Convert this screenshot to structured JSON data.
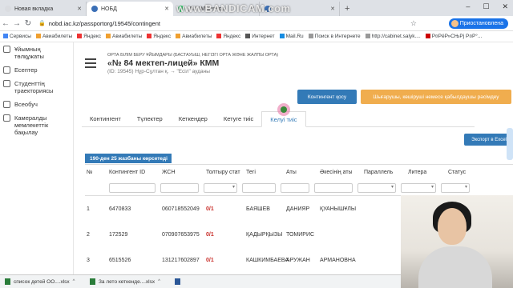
{
  "browser": {
    "tabs": [
      {
        "title": "Новая вкладка",
        "color": "#dadce0",
        "active": false
      },
      {
        "title": "НОБД",
        "color": "#3b6fb6",
        "active": true
      },
      {
        "title": "(63) WhatsApp",
        "color": "#25d366",
        "active": false
      },
      {
        "title": "",
        "color": "#3b6fb6",
        "active": false
      }
    ],
    "new_tab": "+",
    "window_buttons": [
      "–",
      "☐",
      "✕"
    ],
    "url": "nobd.iac.kz/passportorg/19545/contingent",
    "profile": "Приостановлена",
    "watermark": "www.BANDICAM.com"
  },
  "bookmarks": [
    "Сервисы",
    "Авиабилеты",
    "Яндекс",
    "Авиабилеты",
    "Яндекс",
    "Авиабилеты",
    "Яндекс",
    "Интернет",
    "Mail.Ru",
    "Поиск в Интернете",
    "http://cabinet.salyk....",
    "Р¤РёР»СЊРј Р¤Р°..."
  ],
  "sidebar": {
    "items": [
      {
        "label": "Ұйымның төлқұжаты",
        "icon": "building-icon"
      },
      {
        "label": "Есептер",
        "icon": "report-icon"
      },
      {
        "label": "Студенттің траекториясы",
        "icon": "student-icon"
      },
      {
        "label": "Всеобуч",
        "icon": "list-icon"
      },
      {
        "label": "Камералды мемлекеттік бақылау",
        "icon": "control-icon"
      }
    ]
  },
  "header": {
    "org_type": "ОРТА БІЛІМ БЕРУ ҰЙЫМДАРЫ (БАСТАУЫШ, НЕГІЗГІ ОРТА ЖӘНЕ ЖАЛПЫ ОРТА)",
    "org_name": "«№ 84 мектеп-лицей» КММ",
    "org_id": "(ID: 19545)  Нұр-Сұлтан қ. → \"Есіл\" ауданы"
  },
  "actions": {
    "add_contingent": "Контингент қосу",
    "orange_action": "Шығарушы, көшіруші немесе қабылдаушы рәсімдеу",
    "export": "Экспорт в Excel"
  },
  "tabs": [
    "Контингент",
    "Түлектер",
    "Кеткендер",
    "Кетуге тиіс",
    "Келуі тиіс"
  ],
  "active_tab_index": 4,
  "table": {
    "badge": "190-ден 25 жазбаны көрсетеді",
    "columns": [
      "№",
      "Контингент ID",
      "ЖСН",
      "Толтыру стат",
      "Тегі",
      "Аты",
      "Әкесінің аты",
      "Параллель",
      "Литера",
      "Статус"
    ],
    "rows": [
      {
        "n": "1",
        "id": "6470833",
        "iin": "060718552049",
        "fill": "0/1",
        "surname": "БАЯШЕВ",
        "name": "ДАНИЯР",
        "patronymic": "ҚУАНЫШҰЛЫ"
      },
      {
        "n": "2",
        "id": "172529",
        "iin": "070907653975",
        "fill": "0/1",
        "surname": "ҚАДЫРҚЫЗЫ",
        "name": "ТОМИРИС",
        "patronymic": ""
      },
      {
        "n": "3",
        "id": "6515526",
        "iin": "131217602897",
        "fill": "0/1",
        "surname": "КАШКИМБАЕВА",
        "name": "АРУЖАН",
        "patronymic": "АРМАНОВНА"
      }
    ]
  },
  "downloads": [
    {
      "name": "список детей ОО....xlsx",
      "type": "xlsx"
    },
    {
      "name": "За лето кеткенде....xlsx",
      "type": "xlsx"
    },
    {
      "name": "",
      "type": "docx"
    }
  ]
}
